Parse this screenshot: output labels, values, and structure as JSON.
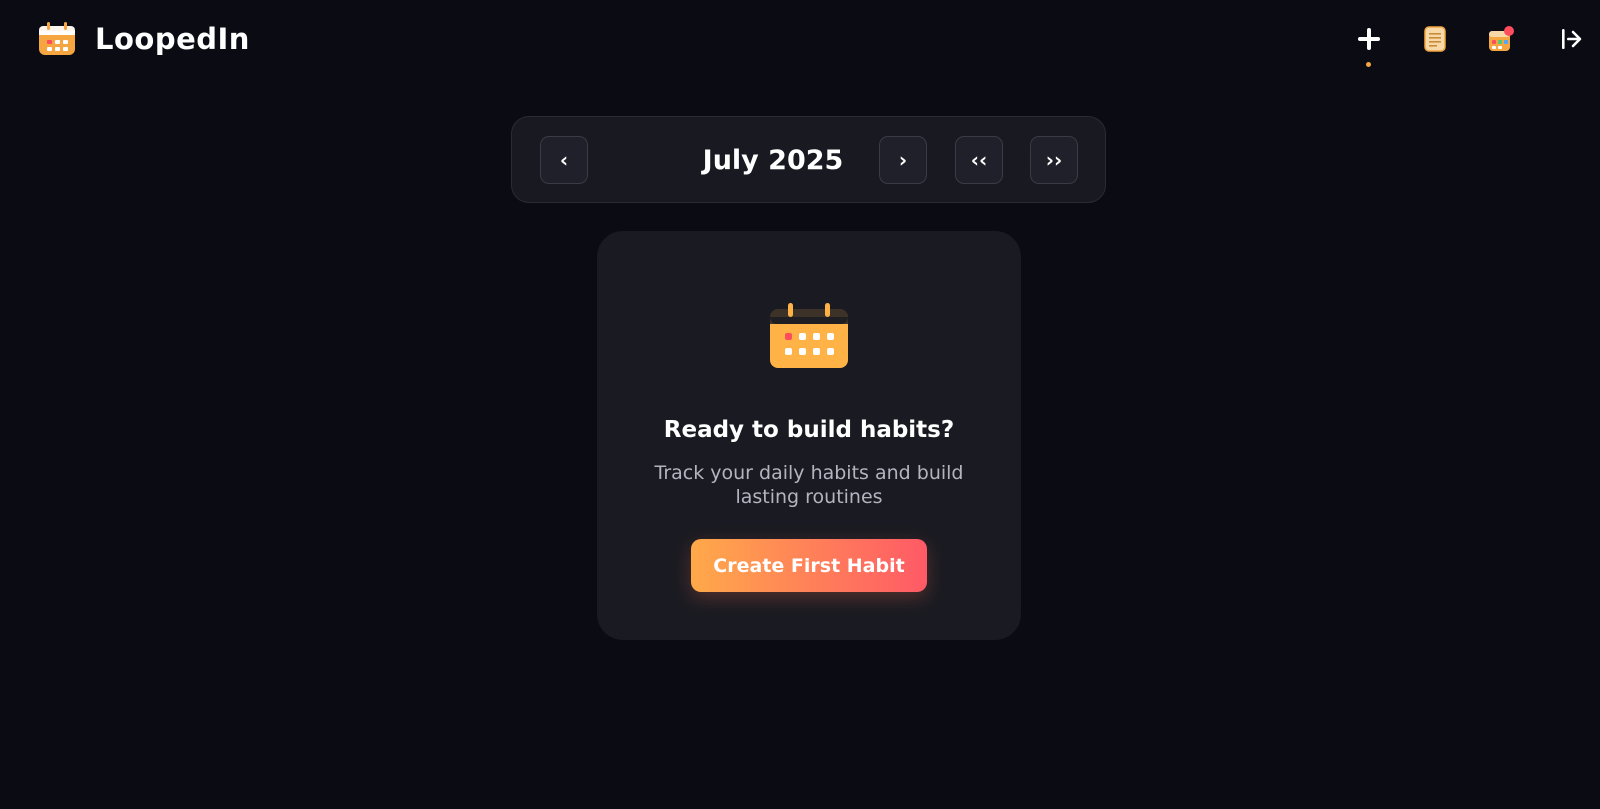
{
  "app": {
    "name": "LoopedIn",
    "logo_icon": "calendar-logo-icon",
    "accent": "#f6a640",
    "background": "#0b0b13"
  },
  "header": {
    "nav": [
      {
        "name": "add-habit-button",
        "icon": "plus-icon",
        "active": true
      },
      {
        "name": "notes-button",
        "icon": "notepad-icon"
      },
      {
        "name": "calendar-view-button",
        "icon": "calendar-badge-icon"
      },
      {
        "name": "logout-button",
        "icon": "logout-arrow-icon"
      }
    ]
  },
  "month_nav": {
    "prev_label": "‹",
    "month_label": "July 2025",
    "next_label": "›",
    "jump_back_label": "‹‹",
    "jump_forward_label": "››"
  },
  "empty_state": {
    "icon": "calendar-icon",
    "title": "Ready to build habits?",
    "subtitle": "Track your daily habits and build lasting routines",
    "cta_label": "Create First Habit",
    "cta_gradient": [
      "#ffa94a",
      "#ff5a66"
    ]
  }
}
